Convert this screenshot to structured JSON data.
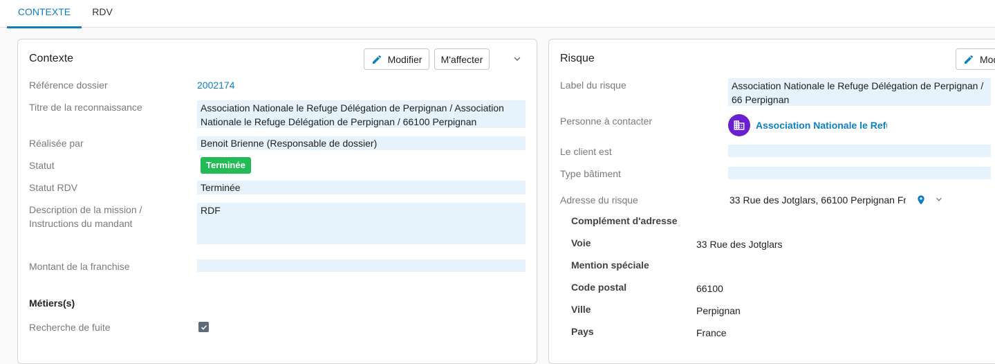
{
  "tabs": [
    {
      "label": "CONTEXTE",
      "active": true
    },
    {
      "label": "RDV",
      "active": false
    }
  ],
  "contexte": {
    "title": "Contexte",
    "modify_label": "Modifier",
    "assign_label": "M'affecter",
    "fields": {
      "reference": {
        "label": "Référence dossier",
        "value": "2002174"
      },
      "titre": {
        "label": "Titre de la reconnaissance",
        "value": "Association Nationale le Refuge Délégation de Perpignan / Association Nationale le Refuge Délégation de Perpignan / 66100 Perpignan"
      },
      "realisee": {
        "label": "Réalisée par",
        "value": "Benoit Brienne (Responsable de dossier)"
      },
      "statut": {
        "label": "Statut",
        "value": "Terminée"
      },
      "statut_rdv": {
        "label": "Statut RDV",
        "value": "Terminée"
      },
      "description": {
        "label": "Description de la mission / Instructions du mandant",
        "value": "RDF"
      },
      "franchise": {
        "label": "Montant de la franchise",
        "value": ""
      }
    },
    "metiers_heading": "Métiers(s)",
    "metiers": [
      {
        "label": "Recherche de fuite",
        "checked": true
      }
    ]
  },
  "risque": {
    "title": "Risque",
    "modify_label": "Mod",
    "fields": {
      "label_risque": {
        "label": "Label du risque",
        "value": "Association Nationale le Refuge Délégation de Perpignan / 66 Perpignan"
      },
      "contact": {
        "label": "Personne à contacter",
        "value": "Association Nationale le Refug"
      },
      "client": {
        "label": "Le client est",
        "value": ""
      },
      "batiment": {
        "label": "Type bâtiment",
        "value": ""
      },
      "adresse": {
        "label": "Adresse du risque",
        "value": "33 Rue des Jotglars, 66100 Perpignan Fr"
      }
    },
    "address_details": [
      {
        "label": "Complément d'adresse",
        "value": ""
      },
      {
        "label": "Voie",
        "value": "33 Rue des Jotglars"
      },
      {
        "label": "Mention spéciale",
        "value": ""
      },
      {
        "label": "Code postal",
        "value": "66100"
      },
      {
        "label": "Ville",
        "value": "Perpignan"
      },
      {
        "label": "Pays",
        "value": "France"
      }
    ]
  },
  "colors": {
    "accent": "#0d7fc0",
    "success": "#22bb55",
    "field_bg": "#e6f3fc",
    "avatar": "#6a1fd1"
  }
}
